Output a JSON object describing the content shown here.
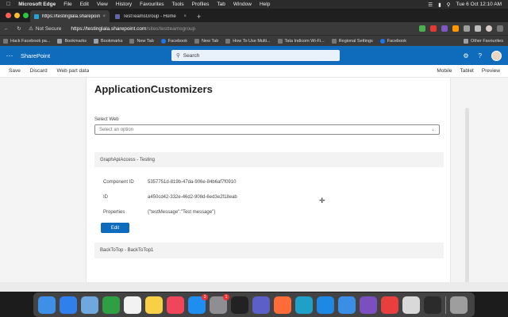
{
  "menubar": {
    "app_name": "Microsoft Edge",
    "items": [
      "File",
      "Edit",
      "View",
      "History",
      "Favourites",
      "Tools",
      "Profiles",
      "Tab",
      "Window",
      "Help"
    ],
    "clock": "Tue 6 Oct  12:10 AM"
  },
  "tabs": [
    {
      "label": "https://testinglala.sharepoint..."
    },
    {
      "label": "TestTeamsGroup - Home"
    }
  ],
  "addressbar": {
    "security": "Not Secure",
    "url_main": "https://testinglala.sharepoint.com",
    "url_rest": "/sites/testteamsgroup"
  },
  "bookmarks": [
    {
      "label": "Hack Facebook pa..."
    },
    {
      "label": "Bookmarks"
    },
    {
      "label": "Bookmarks"
    },
    {
      "label": "New Tab"
    },
    {
      "label": "Facebook"
    },
    {
      "label": "New Tab"
    },
    {
      "label": "How To Use Multi..."
    },
    {
      "label": "Tata Indicom Wi-Fi..."
    },
    {
      "label": "Regional Settings"
    },
    {
      "label": "Facebook"
    }
  ],
  "bookmarks_other": "Other Favourites",
  "suitebar": {
    "title": "SharePoint",
    "search_placeholder": "Search"
  },
  "commandbar": {
    "left": [
      "Save",
      "Discard",
      "Web part data"
    ],
    "right": [
      "Mobile",
      "Tablet",
      "Preview"
    ]
  },
  "page": {
    "title": "ApplicationCustomizers",
    "select_label": "Select Web",
    "select_placeholder": "Select an option",
    "section1": "GraphApiAccess - Testing",
    "details": [
      {
        "key": "Component ID",
        "value": "5357751d-819b-47da-906e-84b6af7f0910"
      },
      {
        "key": "ID",
        "value": "a450cd42-332e-46d2-908d-6ed3e2f18eab"
      },
      {
        "key": "Properties",
        "value": "{\"testMessage\":\"Test message\"}"
      }
    ],
    "edit_label": "Edit",
    "section2": "BackToTop - BackToTop1"
  },
  "dock": {
    "apps": [
      {
        "name": "finder",
        "color": "#3d8fe8"
      },
      {
        "name": "safari",
        "color": "#2f80ed"
      },
      {
        "name": "preview",
        "color": "#6fa8dc"
      },
      {
        "name": "facetime",
        "color": "#2ea043"
      },
      {
        "name": "calendar",
        "color": "#f2f2f2"
      },
      {
        "name": "notes",
        "color": "#f7d046"
      },
      {
        "name": "music",
        "color": "#f0465b"
      },
      {
        "name": "app-store",
        "color": "#1f8ef1",
        "badge": "3"
      },
      {
        "name": "system-preferences",
        "color": "#8e8e93",
        "badge": "1"
      },
      {
        "name": "terminal",
        "color": "#222222"
      },
      {
        "name": "teams",
        "color": "#5b5fc7"
      },
      {
        "name": "postman",
        "color": "#ff6c37"
      },
      {
        "name": "edge",
        "color": "#1fa0c9"
      },
      {
        "name": "vscode",
        "color": "#1e88e5"
      },
      {
        "name": "azure-data-studio",
        "color": "#3a8ee6"
      },
      {
        "name": "visual-studio",
        "color": "#7b4fbf"
      },
      {
        "name": "anydesk",
        "color": "#e83e3e"
      },
      {
        "name": "script-editor",
        "color": "#d9d9d9"
      },
      {
        "name": "obs",
        "color": "#2b2b2b"
      },
      {
        "name": "trash",
        "color": "#9e9e9e"
      }
    ]
  }
}
